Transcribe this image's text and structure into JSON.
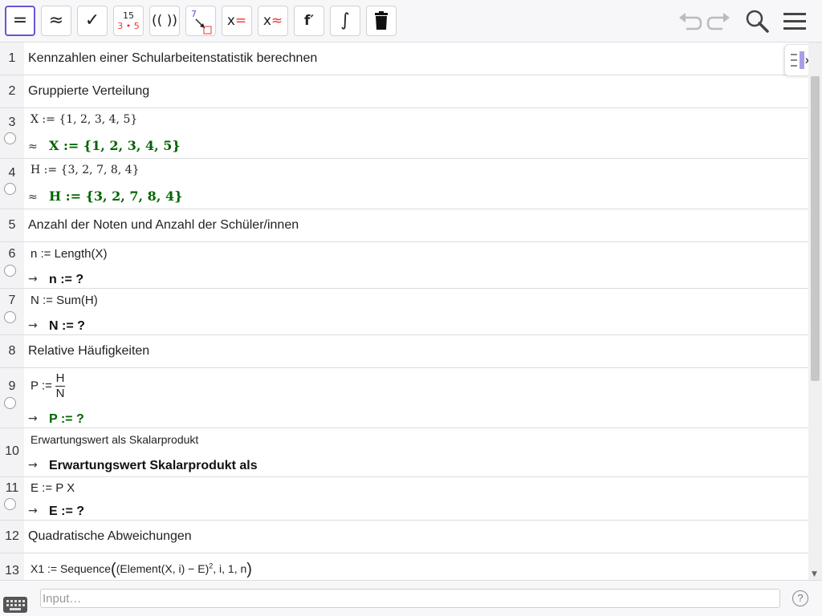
{
  "toolbar": {
    "equals_icon": "=",
    "approx_icon": "≈",
    "check_icon": "✓",
    "fraction_top": "15",
    "fraction_bottom": "3 • 5",
    "factor_icon": "(( ))",
    "substitute_num": "7",
    "solve_x": "x",
    "solve_eq": "=",
    "nsolve_x": "x",
    "nsolve_eq": "≈",
    "derivative_icon": "f′",
    "integral_icon": "∫",
    "colors": {
      "accent": "#6557d2",
      "red": "#e33333",
      "green": "#006400"
    }
  },
  "sidepanel": {
    "label": "x="
  },
  "rows": [
    {
      "num": "1",
      "text": "Kennzahlen einer Schularbeitenstatistik berechnen"
    },
    {
      "num": "2",
      "text": "Gruppierte Verteilung"
    },
    {
      "num": "3",
      "input": "X := {1, 2, 3, 4, 5}",
      "sym": "≈",
      "output": "X := {1, 2, 3, 4, 5}"
    },
    {
      "num": "4",
      "input": "H := {3, 2, 7, 8, 4}",
      "sym": "≈",
      "output": "H := {3, 2, 7, 8, 4}"
    },
    {
      "num": "5",
      "text": "Anzahl der Noten und Anzahl der Schüler/innen"
    },
    {
      "num": "6",
      "input": "n := Length(X)",
      "sym": "→",
      "output": "n := ?"
    },
    {
      "num": "7",
      "input": "N := Sum(H)",
      "sym": "→",
      "output": "N := ?"
    },
    {
      "num": "8",
      "text": "Relative Häufigkeiten"
    },
    {
      "num": "9",
      "input_prefix": "P :=",
      "frac_num": "H",
      "frac_den": "N",
      "sym": "→",
      "output": "P := ?"
    },
    {
      "num": "10",
      "input": "Erwartungswert als Skalarprodukt",
      "sym": "→",
      "output": "Erwartungswert Skalarprodukt als"
    },
    {
      "num": "11",
      "input": "E := P X",
      "sym": "→",
      "output": "E := ?"
    },
    {
      "num": "12",
      "text": "Quadratische Abweichungen"
    },
    {
      "num": "13",
      "input_pre": "X1 := Sequence",
      "input_mid": "(Element(X, i) − E)",
      "input_exp": "2",
      "input_post": ", i, 1, n"
    }
  ],
  "input_bar": {
    "placeholder": "Input…",
    "help": "?"
  }
}
